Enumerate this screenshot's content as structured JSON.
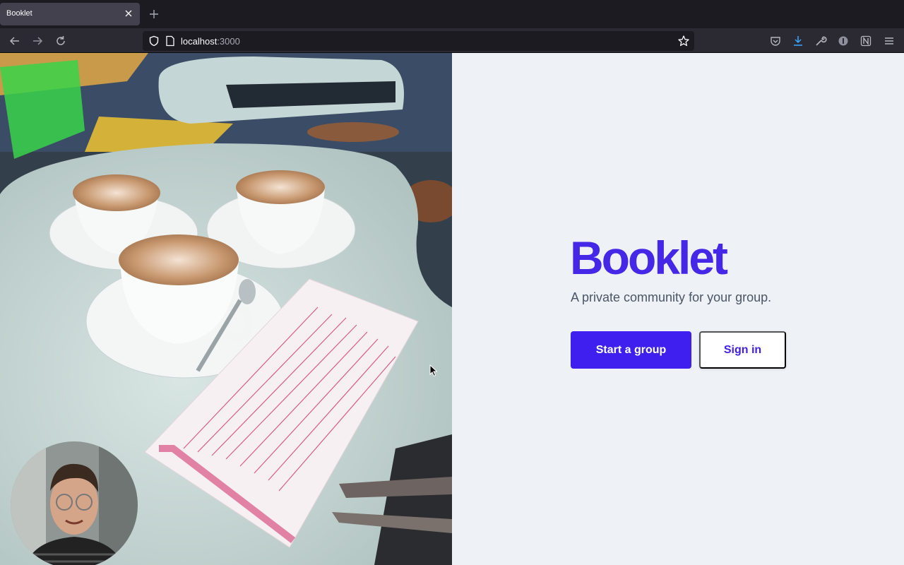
{
  "browser": {
    "tab_title": "Booklet",
    "url_host": "localhost",
    "url_port": ":3000"
  },
  "icons": {
    "back": "back-arrow-icon",
    "forward": "forward-arrow-icon",
    "reload": "reload-icon",
    "shield": "shield-icon",
    "page": "page-icon",
    "bookmark": "star-icon",
    "pocket": "pocket-icon",
    "downloads": "download-icon",
    "tools": "wrench-icon",
    "extension": "extension-icon",
    "notion": "notion-icon",
    "menu": "hamburger-menu-icon"
  },
  "hero": {
    "brand": "Booklet",
    "tagline": "A private community for your group.",
    "primary_cta": "Start a group",
    "secondary_cta": "Sign in"
  },
  "colors": {
    "brand": "#4527e8",
    "primary_button": "#3f1ff0",
    "panel_background": "#eef1f5",
    "tagline": "#4a5566"
  }
}
